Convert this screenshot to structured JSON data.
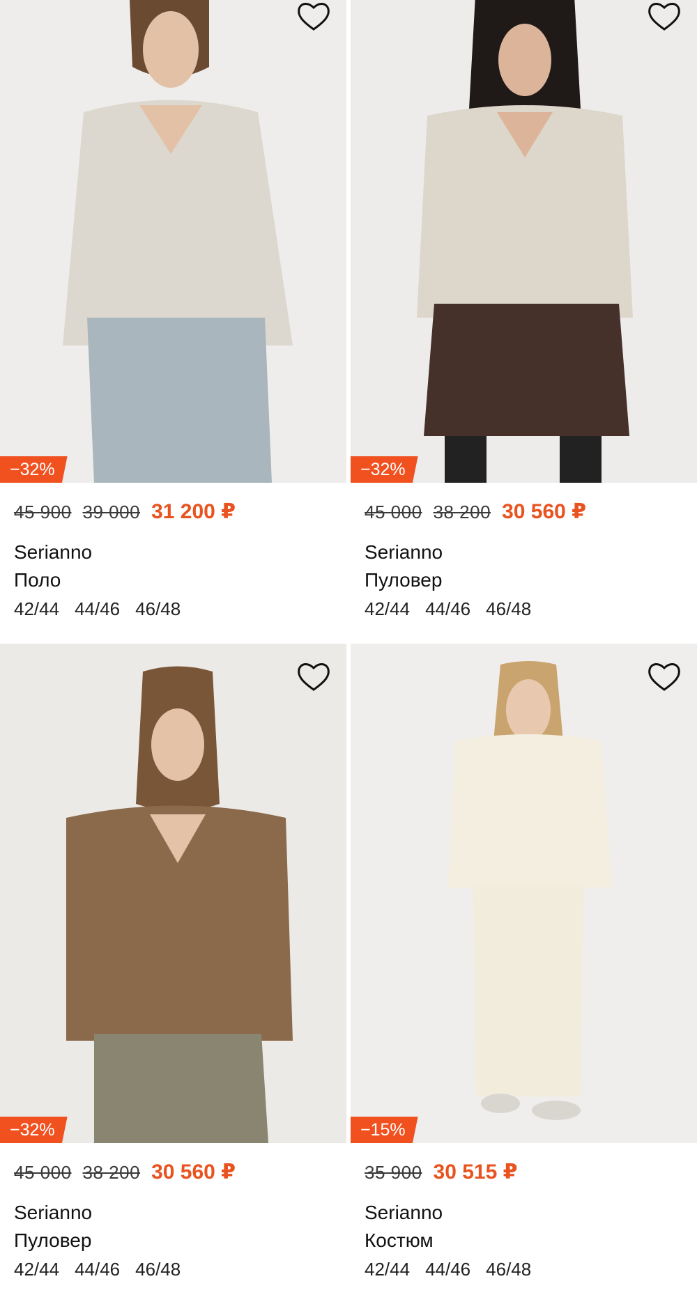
{
  "products": [
    {
      "badge": "−32%",
      "price_old_1": "45 900",
      "price_old_2": "39 000",
      "price_new": "31 200 ₽",
      "brand": "Serianno",
      "type": "Поло",
      "sizes": [
        "42/44",
        "44/46",
        "46/48"
      ],
      "image": "woman-in-beige-polo-sweater-and-jeans"
    },
    {
      "badge": "−32%",
      "price_old_1": "45 000",
      "price_old_2": "38 200",
      "price_new": "30 560 ₽",
      "brand": "Serianno",
      "type": "Пуловер",
      "sizes": [
        "42/44",
        "44/46",
        "46/48"
      ],
      "image": "woman-in-beige-v-neck-pullover-and-brown-shorts"
    },
    {
      "badge": "−32%",
      "price_old_1": "45 000",
      "price_old_2": "38 200",
      "price_new": "30 560 ₽",
      "brand": "Serianno",
      "type": "Пуловер",
      "sizes": [
        "42/44",
        "44/46",
        "46/48"
      ],
      "image": "woman-in-brown-v-neck-pullover"
    },
    {
      "badge": "−15%",
      "price_old_1": "35 900",
      "price_old_2": "",
      "price_new": "30 515 ₽",
      "brand": "Serianno",
      "type": "Костюм",
      "sizes": [
        "42/44",
        "44/46",
        "46/48"
      ],
      "image": "woman-in-cream-knit-suit"
    }
  ],
  "icons": {
    "favorite": "heart-outline-icon"
  },
  "colors": {
    "accent": "#e8531f",
    "badge": "#f1501f"
  }
}
